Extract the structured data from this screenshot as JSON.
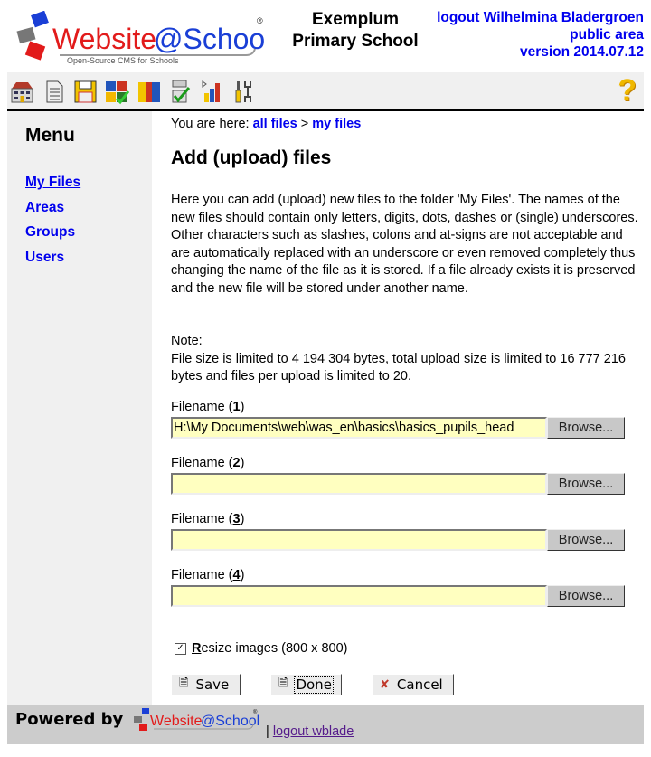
{
  "header": {
    "logo_text_main": "Website",
    "logo_text_at": "@School",
    "logo_tagline": "Open-Source CMS for Schools",
    "school_line1": "Exemplum",
    "school_line2": "Primary School",
    "logout_label": "logout Wilhelmina Bladergroen",
    "area_label": "public area",
    "version_label": "version 2014.07.12"
  },
  "toolbar": {
    "icons": [
      "home-icon",
      "page-icon",
      "save-disk-icon",
      "modules-icon",
      "users-icon",
      "checklist-icon",
      "stats-icon",
      "tools-icon"
    ],
    "help": "?"
  },
  "sidebar": {
    "title": "Menu",
    "items": [
      {
        "label": "My Files",
        "active": true
      },
      {
        "label": "Areas"
      },
      {
        "label": "Groups"
      },
      {
        "label": "Users"
      }
    ]
  },
  "breadcrumb": {
    "prefix": "You are here:",
    "items": [
      "all files",
      "my files"
    ],
    "separator": ">"
  },
  "page_title": "Add (upload) files",
  "intro": "Here you can add (upload) new files to the folder 'My Files'. The names of the new files should contain only letters, digits, dots, dashes or (single) underscores. Other characters such as slashes, colons and at-signs are not acceptable and are automatically replaced with an underscore or even removed completely thus changing the name of the file as it is stored. If a file already exists it is preserved and the new file will be stored under another name.",
  "note": {
    "label": "Note:",
    "text": "File size is limited to 4 194 304 bytes, total upload size is limited to 16 777 216 bytes and files per upload is limited to 20."
  },
  "fields": [
    {
      "label": "Filename (",
      "key": "1",
      "suffix": ")",
      "value": "H:\\My Documents\\web\\was_en\\basics\\basics_pupils_head",
      "browse": "Browse..."
    },
    {
      "label": "Filename (",
      "key": "2",
      "suffix": ")",
      "value": "",
      "browse": "Browse..."
    },
    {
      "label": "Filename (",
      "key": "3",
      "suffix": ")",
      "value": "",
      "browse": "Browse..."
    },
    {
      "label": "Filename (",
      "key": "4",
      "suffix": ")",
      "value": "",
      "browse": "Browse..."
    }
  ],
  "resize": {
    "checked": true,
    "key": "R",
    "label_rest": "esize images (800 x 800)"
  },
  "buttons": {
    "save": "Save",
    "done": "Done",
    "cancel": "Cancel"
  },
  "footer": {
    "powered_by": "Powered by",
    "separator": "|",
    "logout": "logout wblade"
  },
  "colors": {
    "link": "#0000ee",
    "visited_link": "#551a8b",
    "input_bg": "#ffffc0",
    "sidebar_bg": "#f0f0f0",
    "footer_bg": "#cccccc"
  }
}
